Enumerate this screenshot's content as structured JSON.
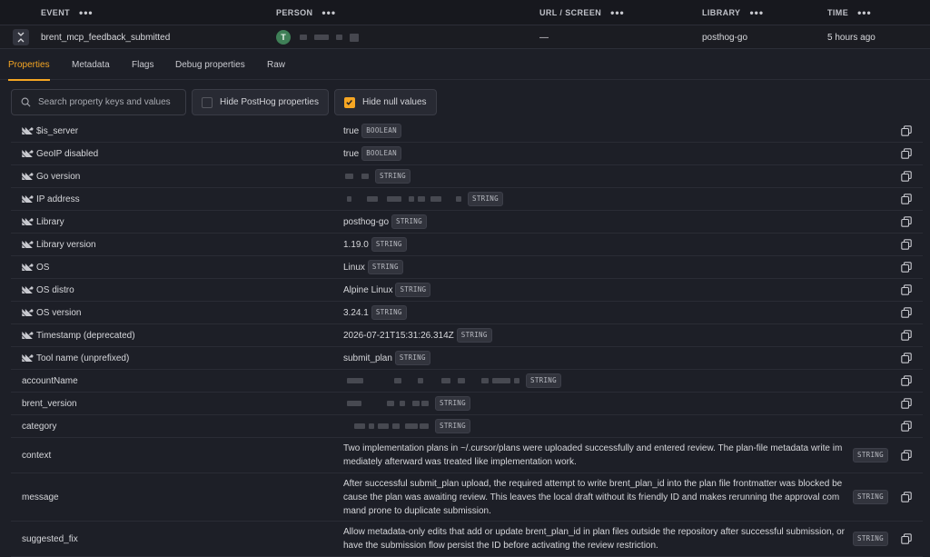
{
  "header": {
    "columns": [
      "EVENT",
      "PERSON",
      "URL / SCREEN",
      "LIBRARY",
      "TIME"
    ],
    "menu_glyph": "•••"
  },
  "event": {
    "name": "brent_mcp_feedback_submitted",
    "person_initial": "T",
    "url": "—",
    "library": "posthog-go",
    "time": "5 hours ago"
  },
  "tabs": [
    "Properties",
    "Metadata",
    "Flags",
    "Debug properties",
    "Raw"
  ],
  "active_tab": "Properties",
  "filters": {
    "search_placeholder": "Search property keys and values",
    "hide_posthog": "Hide PostHog properties",
    "hide_null": "Hide null values",
    "hide_posthog_checked": false,
    "hide_null_checked": true
  },
  "properties": [
    {
      "key": "$is_server",
      "value": "true",
      "type": "BOOLEAN",
      "posthog": true
    },
    {
      "key": "GeoIP disabled",
      "value": "true",
      "type": "BOOLEAN",
      "posthog": true
    },
    {
      "key": "Go version",
      "value": "",
      "type": "STRING",
      "posthog": true,
      "redacted": true
    },
    {
      "key": "IP address",
      "value": "",
      "type": "STRING",
      "posthog": true,
      "redacted": true
    },
    {
      "key": "Library",
      "value": "posthog-go",
      "type": "STRING",
      "posthog": true
    },
    {
      "key": "Library version",
      "value": "1.19.0",
      "type": "STRING",
      "posthog": true
    },
    {
      "key": "OS",
      "value": "Linux",
      "type": "STRING",
      "posthog": true
    },
    {
      "key": "OS distro",
      "value": "Alpine Linux",
      "type": "STRING",
      "posthog": true
    },
    {
      "key": "OS version",
      "value": "3.24.1",
      "type": "STRING",
      "posthog": true
    },
    {
      "key": "Timestamp (deprecated)",
      "value": "2026-07-21T15:31:26.314Z",
      "type": "STRING",
      "posthog": true
    },
    {
      "key": "Tool name (unprefixed)",
      "value": "submit_plan",
      "type": "STRING",
      "posthog": true
    },
    {
      "key": "accountName",
      "value": "",
      "type": "STRING",
      "posthog": false,
      "redacted": true
    },
    {
      "key": "brent_version",
      "value": "",
      "type": "STRING",
      "posthog": false,
      "redacted": true
    },
    {
      "key": "category",
      "value": "",
      "type": "STRING",
      "posthog": false,
      "redacted": true
    },
    {
      "key": "context",
      "value": "Two implementation plans in ~/.cursor/plans were uploaded successfully and entered review. The plan-file metadata write im mediately afterward was treated like implementation work.",
      "type": "STRING",
      "posthog": false,
      "long": true
    },
    {
      "key": "message",
      "value": "After successful submit_plan upload, the required attempt to write brent_plan_id into the plan file frontmatter was blocked be cause the plan was awaiting review. This leaves the local draft without its friendly ID and makes rerunning the approval com mand prone to duplicate submission.",
      "type": "STRING",
      "posthog": false,
      "long": true
    },
    {
      "key": "suggested_fix",
      "value": "Allow metadata-only edits that add or update brent_plan_id in plan files outside the repository after successful submission, or have the submission flow persist the ID before activating the review restriction.",
      "type": "STRING",
      "posthog": false,
      "long": true
    }
  ]
}
